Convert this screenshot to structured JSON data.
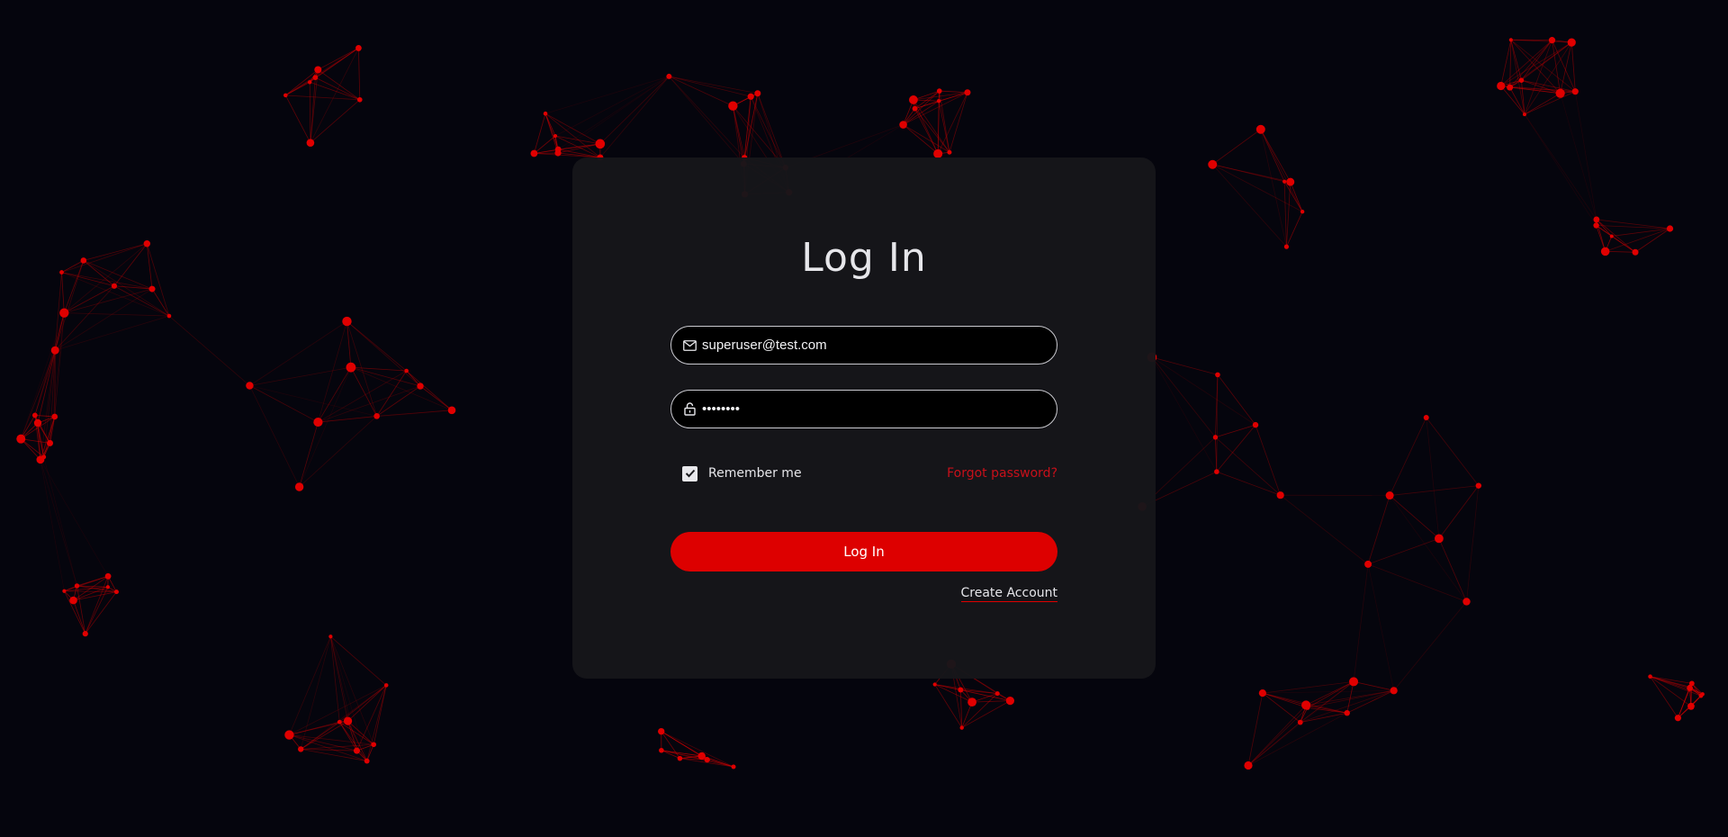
{
  "login": {
    "title": "Log In",
    "email": {
      "value": "superuser@test.com",
      "icon": "mail-icon"
    },
    "password": {
      "value": "••••••••",
      "icon": "lock-icon"
    },
    "remember_label": "Remember me",
    "remember_checked": true,
    "forgot_label": "Forgot password?",
    "submit_label": "Log In",
    "create_account_label": "Create Account"
  },
  "theme": {
    "background": "#05050d",
    "card": "#16161a",
    "accent": "#dd0000",
    "link_accent": "#c8101a",
    "node_color": "#e00000"
  }
}
